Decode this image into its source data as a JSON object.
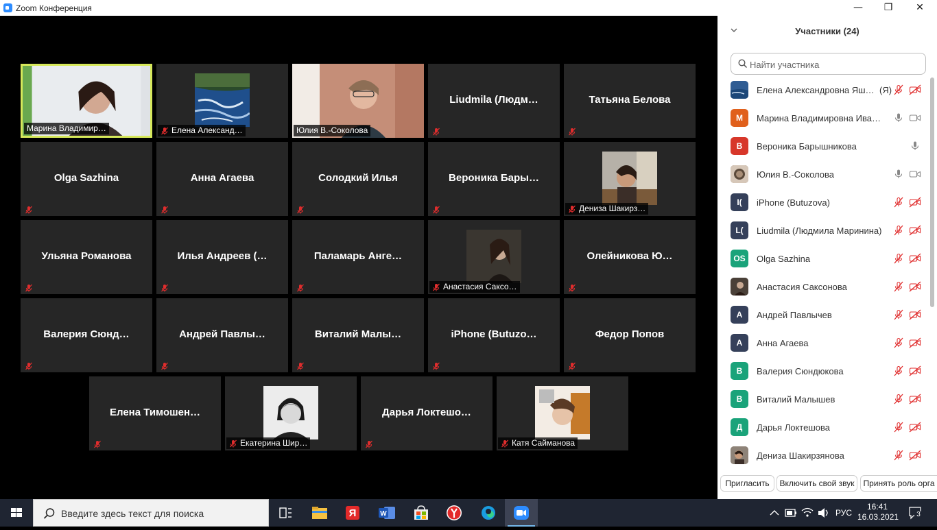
{
  "window": {
    "title": "Zoom Конференция",
    "minimize": "—",
    "maximize": "❐",
    "close": "✕"
  },
  "tiles": [
    {
      "name": "Марина Владимир…",
      "label": "Марина Владимир…",
      "kind": "video",
      "active": true,
      "muted": false
    },
    {
      "name": "Елена Александ…",
      "label": "Елена Александ…",
      "kind": "thumb-river",
      "muted": true
    },
    {
      "name": "Юлия В.-Соколова",
      "label": "Юлия В.-Соколова",
      "kind": "video2",
      "muted": false
    },
    {
      "name": "Liudmila  (Людм…",
      "kind": "text",
      "muted": true
    },
    {
      "name": "Татьяна Белова",
      "kind": "text",
      "muted": true
    },
    {
      "name": "Olga Sazhina",
      "kind": "text",
      "muted": true
    },
    {
      "name": "Анна Агаева",
      "kind": "text",
      "muted": true
    },
    {
      "name": "Солодкий Илья",
      "kind": "text",
      "muted": true
    },
    {
      "name": "Вероника  Бары…",
      "kind": "text",
      "muted": true
    },
    {
      "name": "Дениза Шакирз…",
      "label": "Дениза Шакирз…",
      "kind": "thumb-photo",
      "muted": true
    },
    {
      "name": "Ульяна Романова",
      "kind": "text",
      "muted": true
    },
    {
      "name": "Илья Андреев (…",
      "kind": "text",
      "muted": true
    },
    {
      "name": "Паламарь  Анге…",
      "kind": "text",
      "muted": true
    },
    {
      "name": "Анастасия Саксо…",
      "label": "Анастасия Саксо…",
      "kind": "thumb-dark",
      "muted": true
    },
    {
      "name": "Олейникова  Ю…",
      "kind": "text",
      "muted": true
    },
    {
      "name": "Валерия  Сюнд…",
      "kind": "text",
      "muted": true
    },
    {
      "name": "Андрей  Павлы…",
      "kind": "text",
      "muted": true
    },
    {
      "name": "Виталий  Малы…",
      "kind": "text",
      "muted": true
    },
    {
      "name": "iPhone  (Butuzo…",
      "kind": "text",
      "muted": true
    },
    {
      "name": "Федор Попов",
      "kind": "text",
      "muted": true
    },
    {
      "name": "Елена  Тимошен…",
      "kind": "text",
      "muted": true
    },
    {
      "name": "Екатерина Шир…",
      "label": "Екатерина Шир…",
      "kind": "thumb-bw",
      "muted": true
    },
    {
      "name": "Дарья  Локтешо…",
      "kind": "text",
      "muted": true
    },
    {
      "name": "Катя Сайманова",
      "label": "Катя Сайманова",
      "kind": "thumb-warm",
      "muted": true
    }
  ],
  "panel": {
    "title": "Участники (24)",
    "collapse_icon": "chevron-down-icon",
    "search_placeholder": "Найти участника",
    "participants": [
      {
        "name": "Елена Александровна Яшк…",
        "me": "(Я)",
        "avatar": "",
        "color": "#3b6ea8",
        "mic": "muted",
        "cam": "off"
      },
      {
        "name": "Марина Владимировна Иванк…",
        "avatar": "М",
        "color": "#e0601c",
        "mic": "on",
        "cam": "on"
      },
      {
        "name": "Вероника Барышникова",
        "avatar": "В",
        "color": "#d7372a",
        "mic": "on",
        "cam": "none"
      },
      {
        "name": "Юлия В.-Соколова",
        "avatar": "",
        "color": "#8a6a55",
        "mic": "on",
        "cam": "on"
      },
      {
        "name": "iPhone (Butuzova)",
        "avatar": "I(",
        "color": "#35405a",
        "mic": "muted",
        "cam": "off"
      },
      {
        "name": "Liudmila (Людмила Маринина)",
        "avatar": "L(",
        "color": "#35405a",
        "mic": "muted",
        "cam": "off"
      },
      {
        "name": "Olga Sazhina",
        "avatar": "OS",
        "color": "#1aa37a",
        "mic": "muted",
        "cam": "off"
      },
      {
        "name": "Анастасия Саксонова",
        "avatar": "",
        "color": "#6b5a4a",
        "mic": "muted",
        "cam": "off"
      },
      {
        "name": "Андрей Павлычев",
        "avatar": "А",
        "color": "#35405a",
        "mic": "muted",
        "cam": "off"
      },
      {
        "name": "Анна Агаева",
        "avatar": "А",
        "color": "#35405a",
        "mic": "muted",
        "cam": "off"
      },
      {
        "name": "Валерия Сюндюкова",
        "avatar": "В",
        "color": "#1aa37a",
        "mic": "muted",
        "cam": "off"
      },
      {
        "name": "Виталий Малышев",
        "avatar": "В",
        "color": "#1aa37a",
        "mic": "muted",
        "cam": "off"
      },
      {
        "name": "Дарья Локтешова",
        "avatar": "Д",
        "color": "#1aa37a",
        "mic": "muted",
        "cam": "off"
      },
      {
        "name": "Дениза Шакирзянова",
        "avatar": "",
        "color": "#5a4a3a",
        "mic": "muted",
        "cam": "off"
      }
    ],
    "footer": {
      "invite": "Пригласить",
      "unmute": "Включить свой звук",
      "claim_host": "Принять роль орга"
    }
  },
  "taskbar": {
    "search_text": "Введите здесь текст для поиска",
    "lang": "РУС",
    "time": "16:41",
    "date": "16.03.2021",
    "notifications": "3",
    "apps": [
      "task-view-icon",
      "file-explorer-icon",
      "yandex-icon",
      "word-icon",
      "store-icon",
      "yandex-browser-icon",
      "edge-icon",
      "zoom-icon"
    ]
  },
  "colors": {
    "active_speaker_border": "#d6e85a",
    "tile_bg": "#262626",
    "mute_red": "#e02d2d",
    "taskbar_bg": "#1f2532"
  }
}
